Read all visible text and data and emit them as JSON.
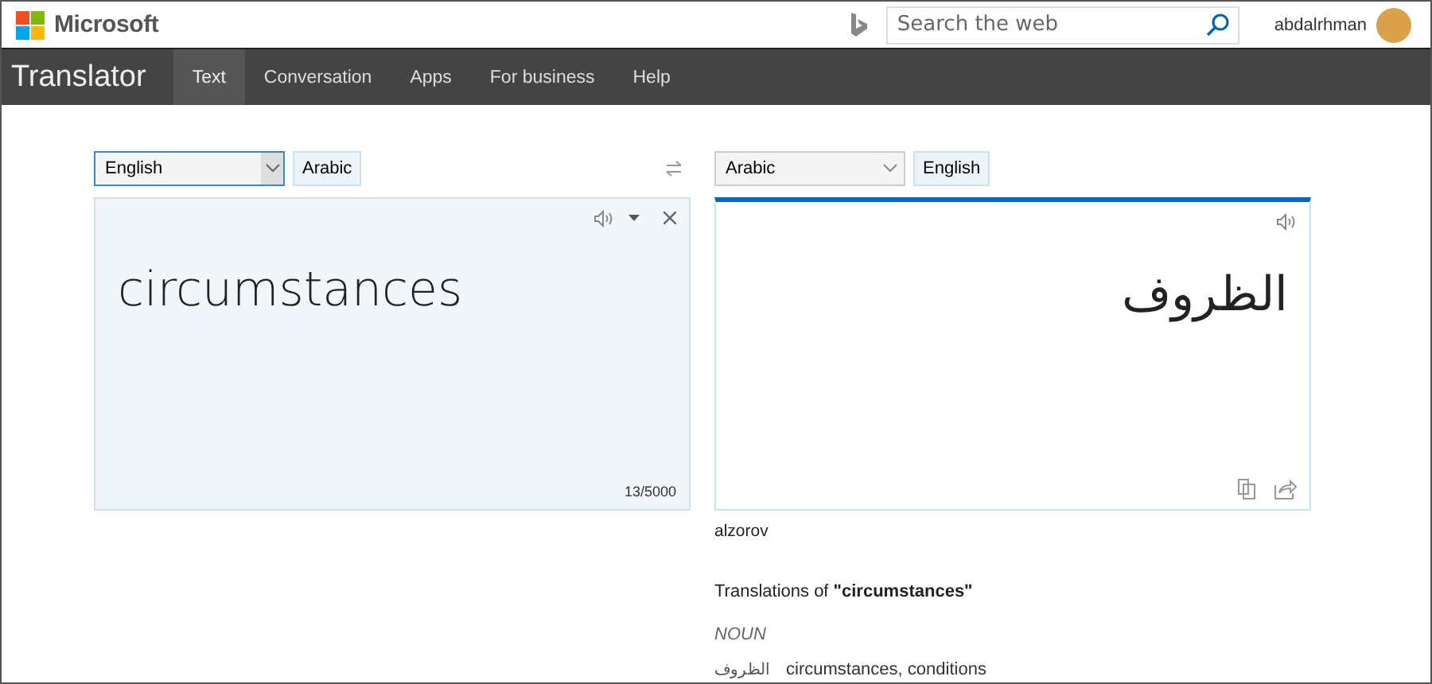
{
  "header": {
    "brand": "Microsoft",
    "search": {
      "placeholder": "Search the web"
    },
    "user": "abdalrhman"
  },
  "nav": {
    "title": "Translator",
    "tabs": [
      {
        "label": "Text",
        "selected": true
      },
      {
        "label": "Conversation",
        "selected": false
      },
      {
        "label": "Apps",
        "selected": false
      },
      {
        "label": "For business",
        "selected": false
      },
      {
        "label": "Help",
        "selected": false
      }
    ]
  },
  "source": {
    "language": "English",
    "alt_language": "Arabic",
    "text": "circumstances",
    "char_count": "13/5000"
  },
  "target": {
    "language": "Arabic",
    "alt_language": "English",
    "text": "الظروف",
    "transliteration": "alzorov"
  },
  "dictionary": {
    "heading": "Translations of  **\"circumstances\"**",
    "part_of_speech": "NOUN",
    "entries": [
      {
        "term": "الظروف",
        "meanings": "circumstances, conditions"
      }
    ]
  }
}
